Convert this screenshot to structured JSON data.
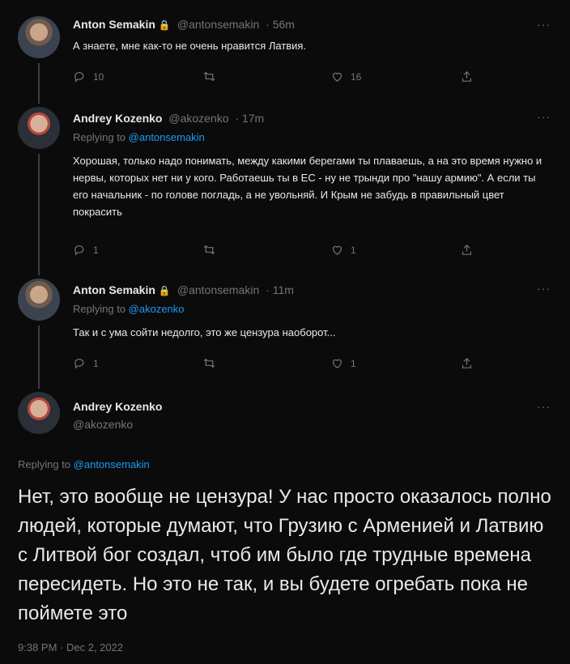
{
  "tweets": [
    {
      "name": "Anton Semakin",
      "handle": "@antonsemakin",
      "time": "· 56m",
      "reply_prefix": "",
      "reply_to": "",
      "text": "А знаете, мне как-то не очень нравится Латвия.",
      "stats": {
        "replies": "10",
        "retweets": "",
        "likes": "16"
      }
    },
    {
      "name": "Andrey Kozenko",
      "handle": "@akozenko",
      "time": "· 17m",
      "reply_prefix": "Replying to ",
      "reply_to": "@antonsemakin",
      "text": "Хорошая, только надо понимать, между какими берегами ты плаваешь, а на это время нужно и нервы, которых нет ни у кого. Работаешь ты в ЕС - ну не трынди про \"нашу армию\". А если ты его начальник - по голове погладь, а не увольняй. И Крым не забудь в правильный цвет покрасить",
      "stats": {
        "replies": "1",
        "retweets": "",
        "likes": "1"
      }
    },
    {
      "name": "Anton Semakin",
      "handle": "@antonsemakin",
      "time": "· 11m",
      "reply_prefix": "Replying to ",
      "reply_to": "@akozenko",
      "text": "Так и с ума сойти недолго, это же цензура наоборот...",
      "stats": {
        "replies": "1",
        "retweets": "",
        "likes": "1"
      }
    }
  ],
  "main": {
    "name": "Andrey Kozenko",
    "handle": "@akozenko",
    "reply_prefix": "Replying to ",
    "reply_to": "@antonsemakin",
    "text": "Нет, это вообще не цензура! У нас просто оказалось полно людей, которые думают, что Грузию с Арменией и Латвию с Литвой бог создал, чтоб им было где трудные времена пересидеть. Но это не так, и вы будете огребать пока не поймете это",
    "timestamp": "9:38 PM · Dec 2, 2022"
  },
  "ui": {
    "more": "···",
    "lock_glyph": "🔒"
  }
}
